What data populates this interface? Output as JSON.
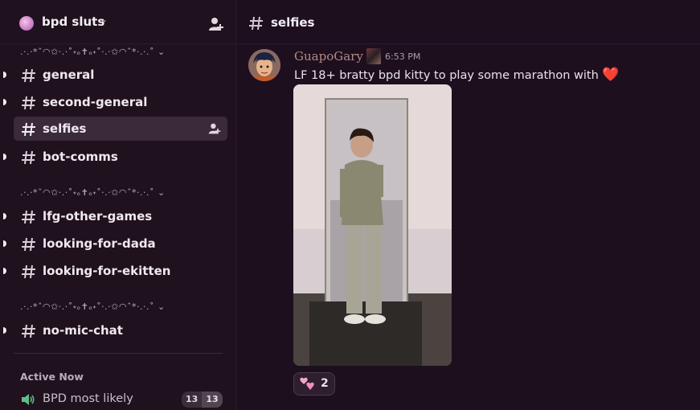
{
  "server": {
    "name": "bpd sluts"
  },
  "categories": [
    {
      "label": ".·.·*ˆ◠✩·.·˚˖ₒ✝ₒ˖˚·.·✩◠ˆ*·.·.˚"
    },
    {
      "label": ".·.·*ˆ◠✩·.·˚˖ₒ✝ₒ˖˚·.·✩◠ˆ*·.·.˚"
    },
    {
      "label": ".·.·*ˆ◠✩·.·˚˖ₒ✝ₒ˖˚·.·✩◠ˆ*·.·.˚"
    }
  ],
  "channels": [
    {
      "label": "general"
    },
    {
      "label": "second-general"
    },
    {
      "label": "selfies"
    },
    {
      "label": "bot-comms"
    },
    {
      "label": "lfg-other-games"
    },
    {
      "label": "looking-for-dada"
    },
    {
      "label": "looking-for-ekitten"
    },
    {
      "label": "no-mic-chat"
    }
  ],
  "active_now": {
    "label": "Active Now"
  },
  "voice": {
    "label": "BPD most likely",
    "badge_left": "13",
    "badge_right": "13"
  },
  "header": {
    "channel": "selfies"
  },
  "message": {
    "author": "GuapoGary",
    "time": "6:53 PM",
    "text": "LF 18+ bratty bpd kitty to play some marathon with",
    "heart": "❤️"
  },
  "reaction": {
    "count": "2"
  },
  "icons": {
    "server": "server-icon",
    "invite": "add-member-icon",
    "hash": "hash-icon",
    "speaker": "speaker-icon",
    "reaction": "pink-hearts-icon"
  },
  "colors": {
    "background": "#1e0f1f",
    "sidebar": "#20111f",
    "active_channel": "#3a2a3a",
    "author": "#b18a84"
  }
}
